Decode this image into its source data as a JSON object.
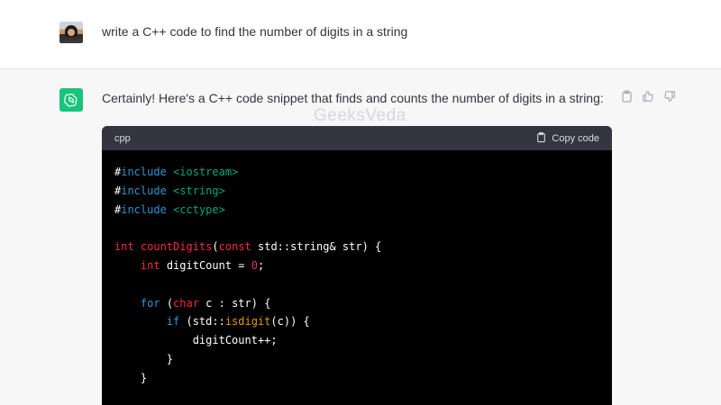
{
  "user_message": {
    "text": "write a C++ code to find the number of digits in a string"
  },
  "assistant_message": {
    "text": "Certainly! Here's a C++ code snippet that finds and counts the number of digits in a string:",
    "watermark": "GeeksVeda"
  },
  "actions": {
    "copy": "clipboard-icon",
    "like": "thumbs-up-icon",
    "dislike": "thumbs-down-icon"
  },
  "code_block": {
    "language": "cpp",
    "copy_label": "Copy code",
    "lines": [
      [
        {
          "t": "#",
          "c": "plain"
        },
        {
          "t": "include",
          "c": "incl"
        },
        {
          "t": " ",
          "c": "plain"
        },
        {
          "t": "<iostream>",
          "c": "str"
        }
      ],
      [
        {
          "t": "#",
          "c": "plain"
        },
        {
          "t": "include",
          "c": "incl"
        },
        {
          "t": " ",
          "c": "plain"
        },
        {
          "t": "<string>",
          "c": "str"
        }
      ],
      [
        {
          "t": "#",
          "c": "plain"
        },
        {
          "t": "include",
          "c": "incl"
        },
        {
          "t": " ",
          "c": "plain"
        },
        {
          "t": "<cctype>",
          "c": "str"
        }
      ],
      [],
      [
        {
          "t": "int",
          "c": "type"
        },
        {
          "t": " ",
          "c": "plain"
        },
        {
          "t": "countDigits",
          "c": "fn"
        },
        {
          "t": "(",
          "c": "plain"
        },
        {
          "t": "const",
          "c": "type"
        },
        {
          "t": " std::string& str) {",
          "c": "plain"
        }
      ],
      [
        {
          "t": "    ",
          "c": "plain"
        },
        {
          "t": "int",
          "c": "type"
        },
        {
          "t": " digitCount = ",
          "c": "plain"
        },
        {
          "t": "0",
          "c": "num"
        },
        {
          "t": ";",
          "c": "plain"
        }
      ],
      [],
      [
        {
          "t": "    ",
          "c": "plain"
        },
        {
          "t": "for",
          "c": "kw"
        },
        {
          "t": " (",
          "c": "plain"
        },
        {
          "t": "char",
          "c": "type"
        },
        {
          "t": " c : str) {",
          "c": "plain"
        }
      ],
      [
        {
          "t": "        ",
          "c": "plain"
        },
        {
          "t": "if",
          "c": "kw"
        },
        {
          "t": " (std::",
          "c": "plain"
        },
        {
          "t": "isdigit",
          "c": "call"
        },
        {
          "t": "(c)) {",
          "c": "plain"
        }
      ],
      [
        {
          "t": "            digitCount++;",
          "c": "plain"
        }
      ],
      [
        {
          "t": "        }",
          "c": "plain"
        }
      ],
      [
        {
          "t": "    }",
          "c": "plain"
        }
      ]
    ]
  },
  "colors": {
    "user_bg": "#ffffff",
    "assistant_bg": "#f7f7f8",
    "avatar_green": "#19c37d",
    "code_bg": "#000000",
    "code_header_bg": "#343541"
  }
}
